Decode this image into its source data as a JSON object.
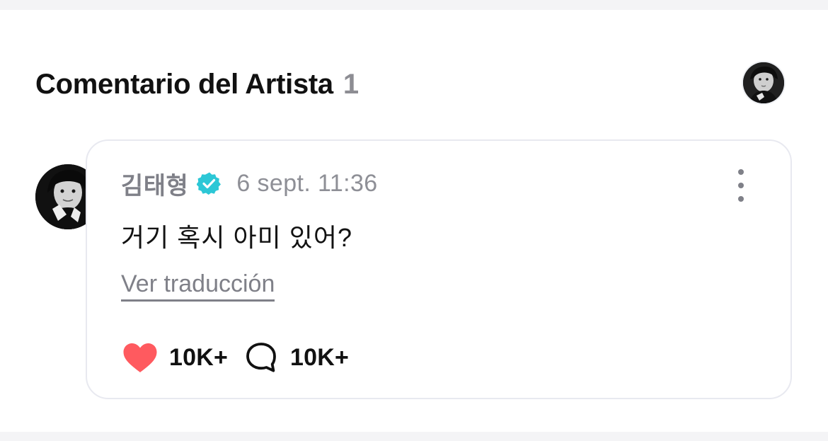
{
  "header": {
    "title": "Comentario del Artista",
    "count": "1"
  },
  "comment": {
    "author": "김태형",
    "timestamp": "6 sept. 11:36",
    "text": "거기 혹시 아미 있어?",
    "translate_label": "Ver traducción",
    "likes": "10K+",
    "replies": "10K+",
    "icons": {
      "verified": "verified-badge-icon",
      "more": "more-vertical-icon",
      "like": "heart-icon",
      "reply": "comment-bubble-icon"
    }
  },
  "colors": {
    "accent": "#2cc7d6",
    "heart": "#ff5a5f",
    "muted_text": "#8e8f96",
    "card_border": "#e8e9f0"
  }
}
